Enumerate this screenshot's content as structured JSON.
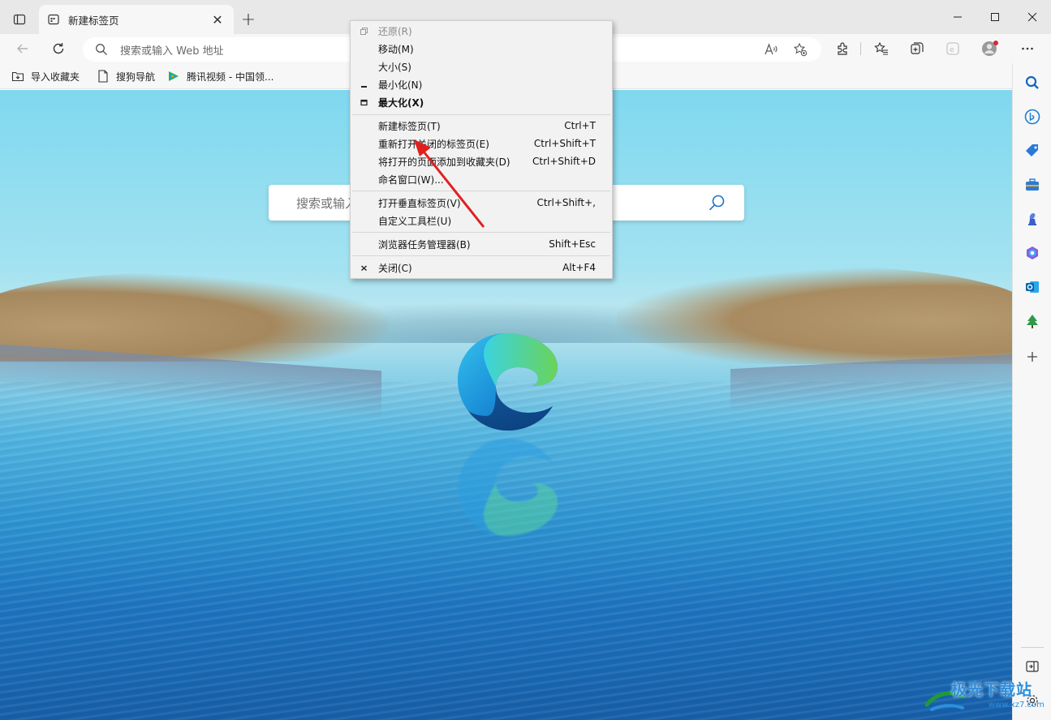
{
  "tab": {
    "title": "新建标签页",
    "close": "✕"
  },
  "newtab": "+",
  "address": {
    "placeholder": "搜索或输入 Web 地址"
  },
  "favorites": [
    {
      "label": "导入收藏夹",
      "icon": "import-folder-icon"
    },
    {
      "label": "搜狗导航",
      "icon": "page-icon"
    },
    {
      "label": "腾讯视频 - 中国领...",
      "icon": "tencent-video-icon"
    }
  ],
  "newtab_page": {
    "search_placeholder": "搜索或输入"
  },
  "context_menu": {
    "items": [
      {
        "label": "还原(R)",
        "shortcut": "",
        "icon": "restore-icon",
        "disabled": true
      },
      {
        "label": "移动(M)",
        "shortcut": ""
      },
      {
        "label": "大小(S)",
        "shortcut": ""
      },
      {
        "label": "最小化(N)",
        "shortcut": "",
        "icon": "minimize-icon"
      },
      {
        "label": "最大化(X)",
        "shortcut": "",
        "icon": "maximize-icon",
        "bold": true
      },
      {
        "label": "新建标签页(T)",
        "shortcut": "Ctrl+T"
      },
      {
        "label": "重新打开关闭的标签页(E)",
        "shortcut": "Ctrl+Shift+T"
      },
      {
        "label": "将打开的页面添加到收藏夹(D)",
        "shortcut": "Ctrl+Shift+D"
      },
      {
        "label": "命名窗口(W)...",
        "shortcut": ""
      },
      {
        "label": "打开垂直标签页(V)",
        "shortcut": "Ctrl+Shift+,"
      },
      {
        "label": "自定义工具栏(U)",
        "shortcut": ""
      },
      {
        "label": "浏览器任务管理器(B)",
        "shortcut": "Shift+Esc"
      },
      {
        "label": "关闭(C)",
        "shortcut": "Alt+F4",
        "icon": "close-icon"
      }
    ]
  },
  "watermark": {
    "text": "极光下载站",
    "url": "www.xz7.com"
  },
  "colors": {
    "accent": "#0f6cbd",
    "annotation_arrow": "#e02020"
  }
}
